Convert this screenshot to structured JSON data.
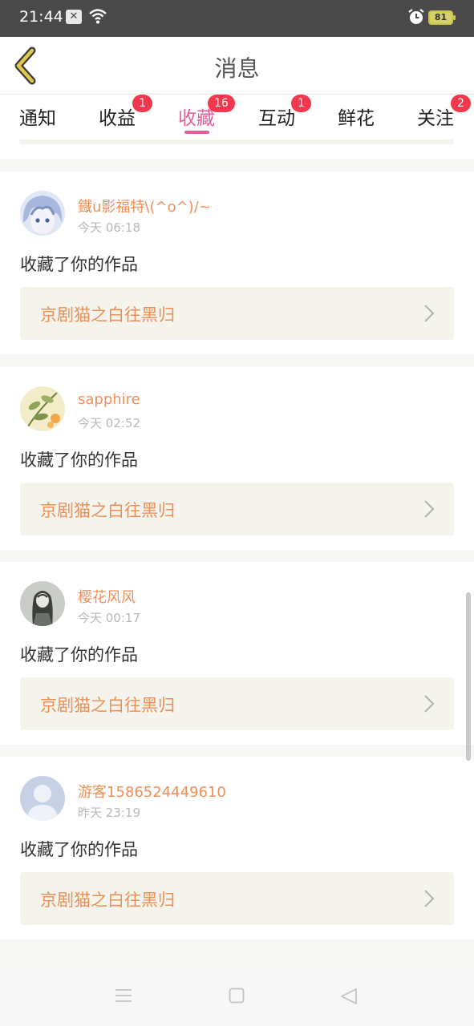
{
  "status_bar": {
    "time": "21:44",
    "battery": "81",
    "icons": [
      "notification-icon",
      "wifi-icon",
      "alarm-icon",
      "battery-icon"
    ]
  },
  "header": {
    "title": "消息",
    "back_icon": "chevron-left-icon"
  },
  "tabs": [
    {
      "label": "通知",
      "badge": ""
    },
    {
      "label": "收益",
      "badge": "1"
    },
    {
      "label": "收藏",
      "badge": "16",
      "active": true
    },
    {
      "label": "互动",
      "badge": "1"
    },
    {
      "label": "鲜花",
      "badge": ""
    },
    {
      "label": "关注",
      "badge": "2"
    }
  ],
  "messages": [
    {
      "username": "鐡u影福特\\(^o^)/~",
      "time": "今天 06:18",
      "action": "收藏了你的作品",
      "work_title": "京剧猫之白往黑归",
      "avatar": "anime-avatar"
    },
    {
      "username": "sapphire",
      "time": "今天 02:52",
      "action": "收藏了你的作品",
      "work_title": "京剧猫之白往黑归",
      "avatar": "botanical-avatar"
    },
    {
      "username": "樱花风风",
      "time": "今天 00:17",
      "action": "收藏了你的作品",
      "work_title": "京剧猫之白往黑归",
      "avatar": "sketch-avatar"
    },
    {
      "username": "游客1586524449610",
      "time": "昨天 23:19",
      "action": "收藏了你的作品",
      "work_title": "京剧猫之白往黑归",
      "avatar": "default-user-avatar"
    }
  ],
  "colors": {
    "accent_pink": "#e0609a",
    "username_orange": "#ee8f57",
    "badge_red": "#f2384c"
  },
  "nav": [
    "menu-icon",
    "home-icon",
    "back-triangle-icon"
  ]
}
